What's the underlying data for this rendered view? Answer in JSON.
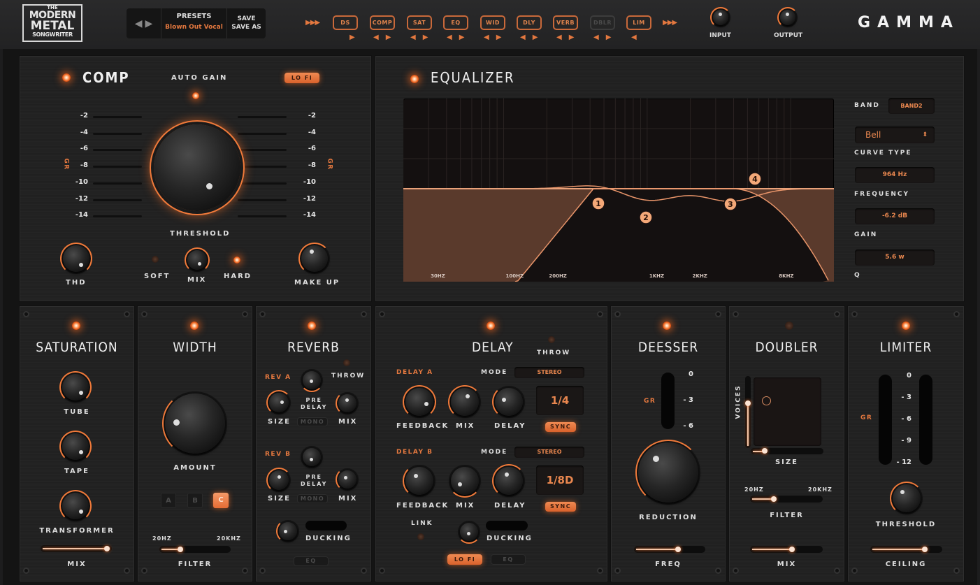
{
  "header": {
    "logo": {
      "line1": "THE",
      "line2": "MODERN",
      "line3": "METAL",
      "line4": "SONGWRITER"
    },
    "presets": {
      "prev_icon": "arrow-left-icon",
      "next_icon": "arrow-right-icon",
      "label": "PRESETS",
      "current": "Blown Out Vocal",
      "save": "SAVE",
      "save_as": "SAVE AS"
    },
    "chain_start_icon": "▶▶▶",
    "chain_end_icon": "▶▶▶",
    "chain": [
      {
        "label": "DS",
        "enabled": true,
        "left": false,
        "right": true
      },
      {
        "label": "COMP",
        "enabled": true,
        "left": true,
        "right": true
      },
      {
        "label": "SAT",
        "enabled": true,
        "left": true,
        "right": true
      },
      {
        "label": "EQ",
        "enabled": true,
        "left": true,
        "right": true
      },
      {
        "label": "WID",
        "enabled": true,
        "left": true,
        "right": true
      },
      {
        "label": "DLY",
        "enabled": true,
        "left": true,
        "right": true
      },
      {
        "label": "VERB",
        "enabled": true,
        "left": true,
        "right": true
      },
      {
        "label": "DBLR",
        "enabled": false,
        "left": true,
        "right": true
      },
      {
        "label": "LIM",
        "enabled": true,
        "left": true,
        "right": false
      }
    ],
    "input_label": "INPUT",
    "output_label": "OUTPUT",
    "product": "GAMMA"
  },
  "comp": {
    "title": "COMP",
    "enabled": true,
    "auto_gain": "AUTO GAIN",
    "lofi": "LO FI",
    "gr_label": "GR",
    "scale": [
      "-2",
      "-4",
      "-6",
      "-8",
      "-10",
      "-12",
      "-14"
    ],
    "threshold": "THRESHOLD",
    "thd": "THD",
    "soft": "SOFT",
    "mix": "MIX",
    "hard": "HARD",
    "make_up": "MAKE UP"
  },
  "eq": {
    "title": "EQUALIZER",
    "enabled": true,
    "freq_labels": [
      "30HZ",
      "100HZ",
      "200HZ",
      "1KHZ",
      "2KHZ",
      "8KHZ"
    ],
    "bands": [
      "1",
      "2",
      "3",
      "4"
    ],
    "band_label": "BAND",
    "band_value": "BAND2",
    "curve_type_value": "Bell",
    "curve_type_label": "CURVE TYPE",
    "frequency_value": "964 Hz",
    "frequency_label": "FREQUENCY",
    "gain_value": "-6.2 dB",
    "gain_label": "GAIN",
    "q_value": "5.6 w",
    "q_label": "Q"
  },
  "saturation": {
    "title": "SATURATION",
    "tube": "TUBE",
    "tape": "TAPE",
    "transformer": "TRANSFORMER",
    "mix": "MIX",
    "mix_value": 1.0
  },
  "width": {
    "title": "WIDTH",
    "amount": "AMOUNT",
    "modes": [
      "A",
      "B",
      "C"
    ],
    "active_mode": "C",
    "filter_low": "20HZ",
    "filter_high": "20KHZ",
    "filter": "FILTER",
    "filter_value": 0.3
  },
  "reverb": {
    "title": "REVERB",
    "throw": "THROW",
    "rev_a": "REV A",
    "rev_b": "REV B",
    "pre_delay_1": "PRE",
    "pre_delay_2": "DELAY",
    "size": "SIZE",
    "mix": "MIX",
    "mono": "MONO",
    "ducking": "DUCKING",
    "eq": "EQ"
  },
  "delay": {
    "title": "DELAY",
    "throw": "THROW",
    "delay_a": "DELAY A",
    "delay_b": "DELAY B",
    "mode": "MODE",
    "mode_a_value": "STEREO",
    "mode_b_value": "STEREO",
    "feedback": "FEEDBACK",
    "mix": "MIX",
    "delay": "DELAY",
    "time_a": "1/4",
    "time_b": "1/8D",
    "sync": "SYNC",
    "link": "LINK",
    "ducking": "DUCKING",
    "lofi": "LO FI",
    "eq": "EQ"
  },
  "deesser": {
    "title": "DEESSER",
    "gr": "GR",
    "scale": [
      "0",
      "- 3",
      "- 6"
    ],
    "reduction": "REDUCTION",
    "freq": "FREQ",
    "freq_value": 0.62
  },
  "doubler": {
    "title": "DOUBLER",
    "enabled": false,
    "voices": "VOICES",
    "voices_value": 0.75,
    "size": "SIZE",
    "size_value": 0.18,
    "filter_low": "20HZ",
    "filter_high": "20KHZ",
    "filter": "FILTER",
    "filter_value": 0.3,
    "mix": "MIX",
    "mix_value": 0.58
  },
  "limiter": {
    "title": "LIMITER",
    "gr": "GR",
    "scale": [
      "0",
      "- 3",
      "- 6",
      "- 9",
      "- 12"
    ],
    "threshold": "THRESHOLD",
    "ceiling": "CEILING",
    "ceiling_value": 0.78
  }
}
